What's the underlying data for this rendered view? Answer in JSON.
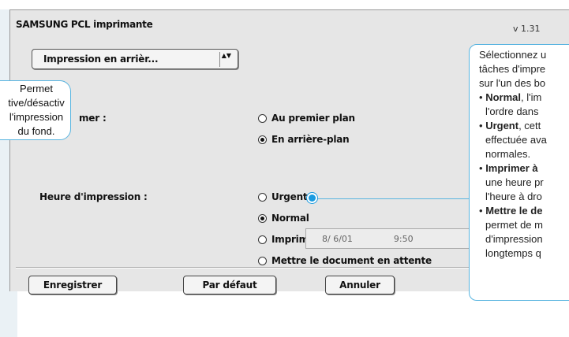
{
  "window": {
    "title": "SAMSUNG PCL imprimante",
    "version": "v 1.31"
  },
  "popup": {
    "label": "Impression en arrièr...",
    "arrows": "▲▼"
  },
  "print_mode": {
    "label": "mer :",
    "options": [
      {
        "label": "Au premier plan",
        "selected": false
      },
      {
        "label": "En arrière-plan",
        "selected": true
      }
    ]
  },
  "print_time": {
    "label": "Heure d'impression :",
    "options": [
      {
        "label": "Urgent",
        "selected": false
      },
      {
        "label": "Normal",
        "selected": true
      },
      {
        "label": "Imprimer à :",
        "selected": false
      },
      {
        "label": "Mettre le document en attente",
        "selected": false
      }
    ],
    "date_value": "8/ 6/01",
    "time_value": "9:50"
  },
  "buttons": {
    "save": "Enregistrer",
    "default": "Par défaut",
    "cancel": "Annuler"
  },
  "callout_left": {
    "lines": [
      "Permet",
      "tive/désactiv",
      "l'impression",
      "du fond."
    ]
  },
  "callout_right": {
    "intro": [
      "Sélectionnez u",
      "tâches d'impre",
      "sur l'un des bo"
    ],
    "items": [
      {
        "bullet": "•",
        "term": "Normal",
        "rest": ", l'im",
        "more": [
          "l'ordre dans"
        ]
      },
      {
        "bullet": "•",
        "term": "Urgent",
        "rest": ", cett",
        "more": [
          "effectuée ava",
          "normales."
        ]
      },
      {
        "bullet": "•",
        "term": "Imprimer à",
        "rest": "",
        "more": [
          "une heure pr",
          "l'heure à dro"
        ]
      },
      {
        "bullet": "•",
        "term": "Mettre le de",
        "rest": "",
        "more": [
          "permet de m",
          "d'impression",
          "longtemps q"
        ]
      }
    ]
  },
  "colors": {
    "callout_border": "#58b4e0",
    "leader_dot": "#1a9be0",
    "dialog_bg": "#e6e6e6"
  }
}
